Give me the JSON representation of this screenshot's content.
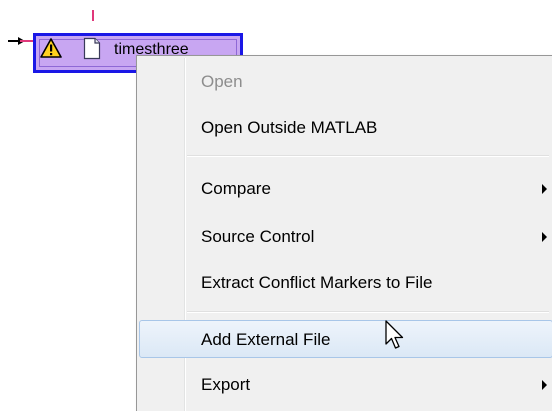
{
  "node": {
    "label": "timesthree",
    "status_icon": "warning-icon",
    "type_icon": "file-icon"
  },
  "context_menu": {
    "items": [
      {
        "label": "Open",
        "enabled": false,
        "submenu": false,
        "highlighted": false
      },
      {
        "label": "Open Outside MATLAB",
        "enabled": true,
        "submenu": false,
        "highlighted": false
      },
      {
        "label": "Compare",
        "enabled": true,
        "submenu": true,
        "highlighted": false
      },
      {
        "label": "Source Control",
        "enabled": true,
        "submenu": true,
        "highlighted": false
      },
      {
        "label": "Extract Conflict Markers to File",
        "enabled": true,
        "submenu": false,
        "highlighted": false
      },
      {
        "label": "Add External File",
        "enabled": true,
        "submenu": false,
        "highlighted": true
      },
      {
        "label": "Export",
        "enabled": true,
        "submenu": true,
        "highlighted": false
      }
    ]
  },
  "colors": {
    "node_fill": "#c8a6f2",
    "node_border": "#1a17e6",
    "menu_background": "#f0f0f0",
    "highlight_border": "#a8c6e8",
    "disabled_text": "#8d8d8d",
    "connector_tick": "#e0387a"
  }
}
